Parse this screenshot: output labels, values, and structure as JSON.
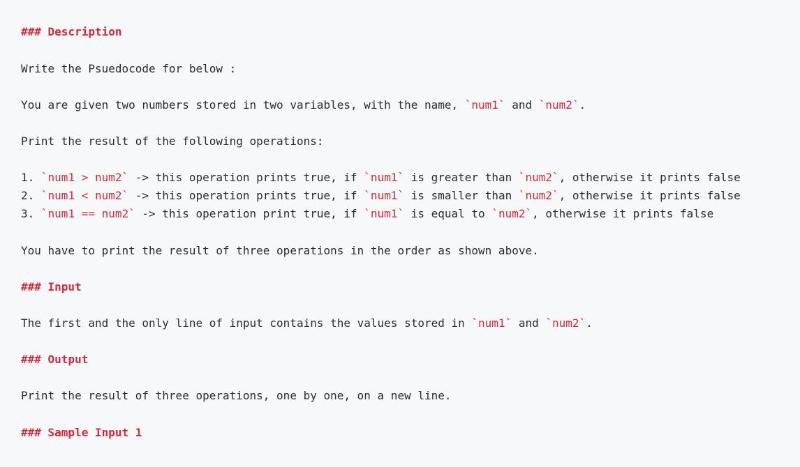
{
  "doc": {
    "description_heading": "### Description",
    "intro_line": "Write the Psuedocode for below :",
    "given": {
      "prefix": "You are given two numbers stored in two variables, with the name, ",
      "code_a": "`num1`",
      "mid": " and ",
      "code_b": "`num2`",
      "suffix": "."
    },
    "print_line": "Print the result of the following operations:",
    "items": [
      {
        "num": "1. ",
        "code_expr": "`num1 > num2`",
        "text1": " -> this operation prints true, if ",
        "code_a": "`num1`",
        "text2": " is greater than ",
        "code_b": "`num2`",
        "text3": ", otherwise it prints false"
      },
      {
        "num": "2. ",
        "code_expr": "`num1 < num2`",
        "text1": " -> this operation prints true, if ",
        "code_a": "`num1`",
        "text2": " is smaller than ",
        "code_b": "`num2`",
        "text3": ", otherwise it prints false"
      },
      {
        "num": "3. ",
        "code_expr": "`num1 == num2`",
        "text1": " -> this operation print true, if ",
        "code_a": "`num1`",
        "text2": " is equal to ",
        "code_b": "`num2`",
        "text3": ", otherwise it prints false"
      }
    ],
    "order_line": "You have to print the result of three operations in the order as shown above.",
    "input_heading": "### Input",
    "input_line": {
      "prefix": "The first and the only line of input contains the values stored in ",
      "code_a": "`num1`",
      "mid": " and ",
      "code_b": "`num2`",
      "suffix": "."
    },
    "output_heading": "### Output",
    "output_line": "Print the result of three operations, one by one, on a new line.",
    "sample_heading": "### Sample Input 1"
  },
  "colors": {
    "background": "#f7f8fa",
    "text": "#2b2b2b",
    "accent": "#d32a3a"
  }
}
